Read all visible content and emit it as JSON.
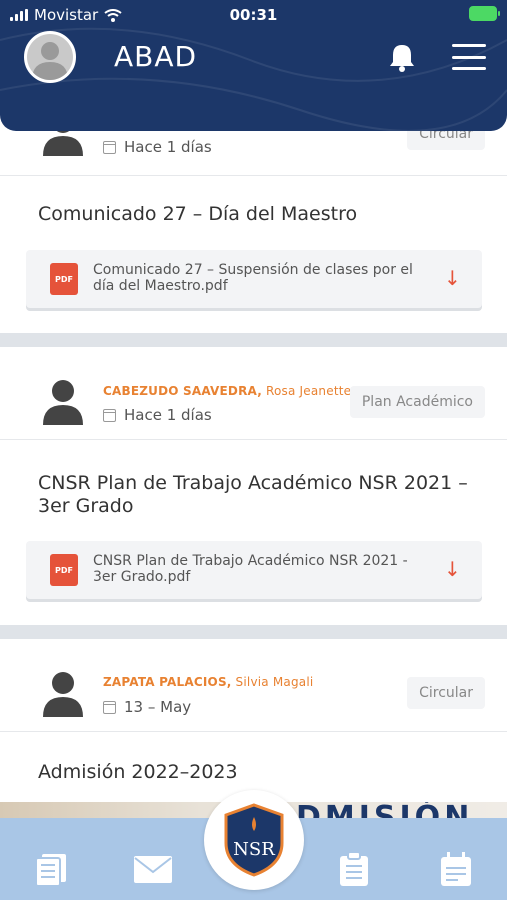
{
  "status_bar": {
    "carrier": "Movistar",
    "time": "00:31"
  },
  "header": {
    "title": "ABAD"
  },
  "posts": [
    {
      "date": "Hace 1 días",
      "tag": "Circular",
      "title": "Comunicado 27 – Día del Maestro",
      "attachment": "Comunicado 27 – Suspensión de clases por el día del Maestro.pdf"
    },
    {
      "author_last": "CABEZUDO SAAVEDRA,",
      "author_first": " Rosa Jeanette",
      "date": "Hace 1 días",
      "tag": "Plan Académico",
      "title": "CNSR Plan de Trabajo Académico NSR 2021 – 3er Grado",
      "attachment": "CNSR Plan de Trabajo Académico NSR 2021 - 3er Grado.pdf"
    },
    {
      "author_last": "ZAPATA PALACIOS,",
      "author_first": " Silvia Magali",
      "date": "13 – May",
      "tag": "Circular",
      "title": "Admisión 2022–2023",
      "banner_text": "DMISIÓN"
    }
  ],
  "pdf_label": "PDF",
  "logo_text": "NSR",
  "bottom_nav": [
    "news-icon",
    "mail-icon",
    "school-logo",
    "clipboard-icon",
    "calendar-icon"
  ],
  "colors": {
    "header": "#1c3769",
    "accent": "#e88232",
    "pdf": "#e5533a",
    "nav": "#a9c6e6"
  }
}
